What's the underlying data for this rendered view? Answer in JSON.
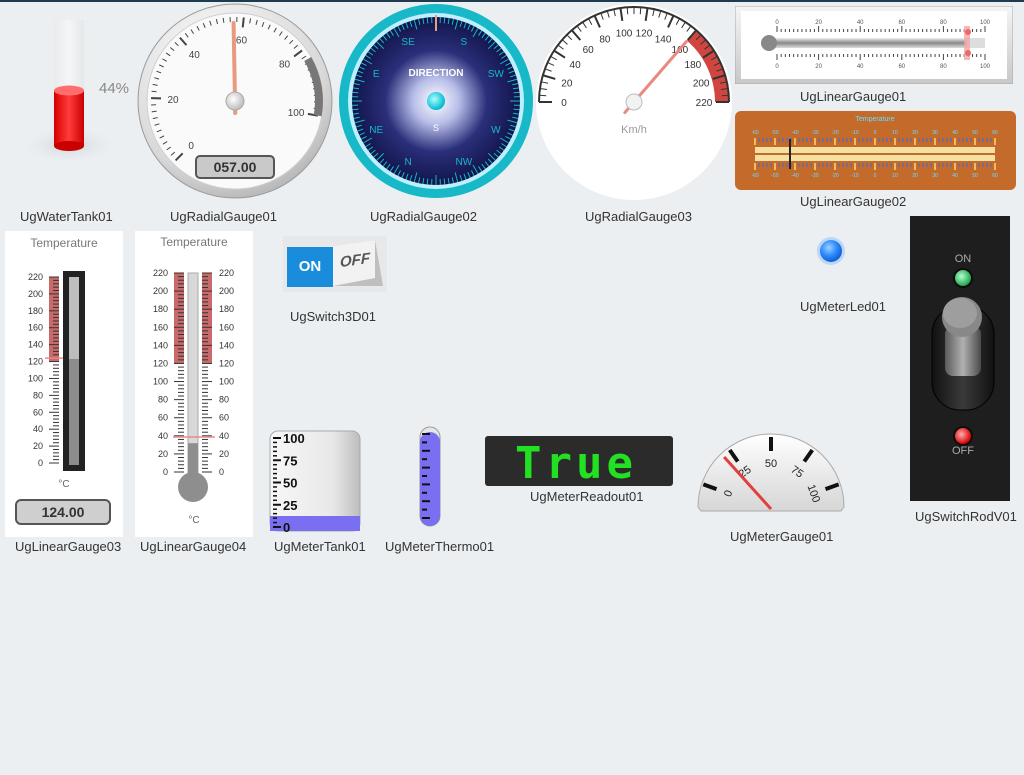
{
  "labels": {
    "water_tank": "UgWaterTank01",
    "radial1": "UgRadialGauge01",
    "radial2": "UgRadialGauge02",
    "radial3": "UgRadialGauge03",
    "linear1": "UgLinearGauge01",
    "linear2": "UgLinearGauge02",
    "linear3": "UgLinearGauge03",
    "linear4": "UgLinearGauge04",
    "switch3d": "UgSwitch3D01",
    "meter_led": "UgMeterLed01",
    "meter_tank": "UgMeterTank01",
    "meter_thermo": "UgMeterThermo01",
    "meter_readout": "UgMeterReadout01",
    "meter_gauge": "UgMeterGauge01",
    "switch_rod": "UgSwitchRodV01"
  },
  "water_tank": {
    "percent_text": "44%",
    "level": 0.44,
    "color": "#ff2a2a"
  },
  "radial1": {
    "ticks": [
      "0",
      "20",
      "40",
      "60",
      "80",
      "100"
    ],
    "readout": "057.00",
    "value": 57
  },
  "radial2": {
    "title": "DIRECTION",
    "points": [
      "SE",
      "S",
      "SW",
      "W",
      "NW",
      "N",
      "NE",
      "E"
    ],
    "center_s": "S",
    "accent": "#17b8c8"
  },
  "radial3": {
    "ticks": [
      "0",
      "20",
      "40",
      "60",
      "80",
      "100",
      "120",
      "140",
      "160",
      "180",
      "200",
      "220"
    ],
    "unit": "Km/h",
    "value": 160
  },
  "linear1": {
    "ticks": [
      "0",
      "20",
      "40",
      "60",
      "80",
      "100"
    ],
    "value": 93
  },
  "linear2": {
    "title": "Temperature",
    "ticks": [
      "-60",
      "-50",
      "-40",
      "-30",
      "-20",
      "-10",
      "0",
      "10",
      "20",
      "30",
      "40",
      "50",
      "60"
    ]
  },
  "linear3": {
    "title": "Temperature",
    "ticks": [
      "220",
      "200",
      "180",
      "160",
      "140",
      "120",
      "100",
      "80",
      "60",
      "40",
      "20",
      "0"
    ],
    "unit": "°C",
    "readout": "124.00",
    "value": 124
  },
  "linear4": {
    "title": "Temperature",
    "ticks": [
      "220",
      "200",
      "180",
      "160",
      "140",
      "120",
      "100",
      "80",
      "60",
      "40",
      "20",
      "0"
    ],
    "unit": "°C",
    "value": 40
  },
  "switch3d": {
    "on": "ON",
    "off": "OFF",
    "on_color": "#1a8cdc"
  },
  "meter_led": {
    "color": "#2f8cff"
  },
  "meter_tank": {
    "ticks": [
      "100",
      "75",
      "50",
      "25",
      "0"
    ],
    "level": 0.15,
    "color": "#7a6ff0"
  },
  "meter_thermo": {
    "level": 0.95,
    "color": "#7a6ff0"
  },
  "meter_readout": {
    "text": "True",
    "color": "#22e022"
  },
  "meter_gauge": {
    "ticks": [
      "0",
      "25",
      "50",
      "75",
      "100"
    ],
    "value": 20
  },
  "switch_rod": {
    "on": "ON",
    "off": "OFF"
  }
}
